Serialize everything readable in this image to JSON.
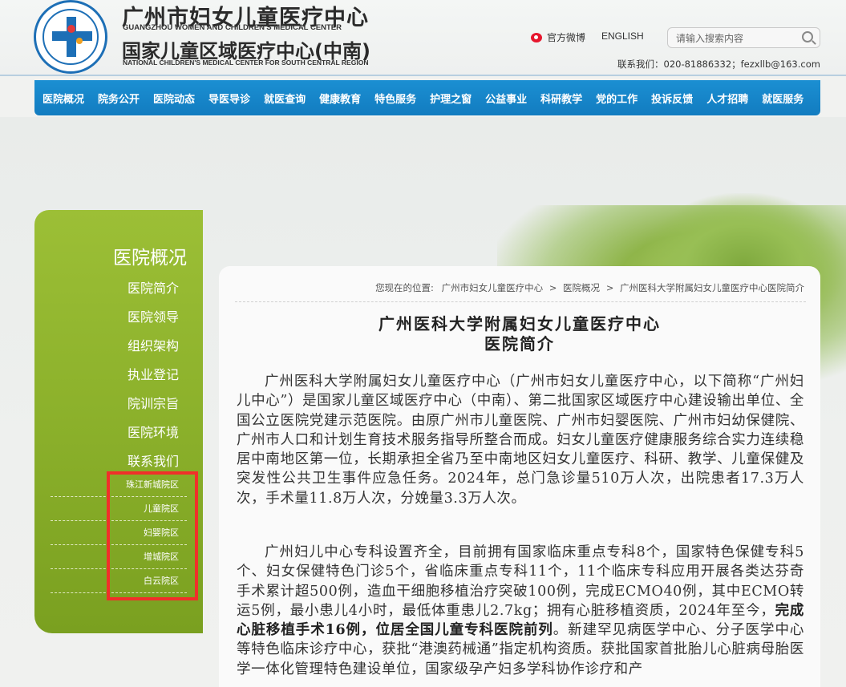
{
  "header": {
    "title_cn": "广州市妇女儿童医疗中心",
    "title_en": "GUANGZHOU WOMEN AND CHILDREN'S MEDICAL CENTER",
    "subtitle_cn": "国家儿童区域医疗中心(中南)",
    "subtitle_en": "NATIONAL CHILDREN'S MEDICAL CENTER FOR SOUTH CENTRAL REGION",
    "weibo_label": "官方微博",
    "english_label": "ENGLISH",
    "search_placeholder": "请输入搜索内容",
    "contact": "联系我们：020-81886332；fezxllb@163.com"
  },
  "nav": {
    "items": [
      "医院概况",
      "院务公开",
      "医院动态",
      "导医导诊",
      "就医查询",
      "健康教育",
      "特色服务",
      "护理之窗",
      "公益事业",
      "科研教学",
      "党的工作",
      "投诉反馈",
      "人才招聘",
      "就医服务"
    ]
  },
  "sidebar": {
    "title": "医院概况",
    "items": [
      "医院简介",
      "医院领导",
      "组织架构",
      "执业登记",
      "院训宗旨",
      "医院环境",
      "联系我们"
    ],
    "sub_items": [
      "珠江新城院区",
      "儿童院区",
      "妇婴院区",
      "增城院区",
      "白云院区"
    ]
  },
  "breadcrumb": {
    "prefix": "您现在的位置:",
    "items": [
      "广州市妇女儿童医疗中心",
      "医院概况",
      "广州医科大学附属妇女儿童医疗中心医院简介"
    ],
    "sep": ">"
  },
  "article": {
    "title_line1": "广州医科大学附属妇女儿童医疗中心",
    "title_line2": "医院简介",
    "para1": "广州医科大学附属妇女儿童医疗中心（广州市妇女儿童医疗中心，以下简称“广州妇儿中心”）是国家儿童区域医疗中心（中南）、第二批国家区域医疗中心建设输出单位、全国公立医院党建示范医院。由原广州市儿童医院、广州市妇婴医院、广州市妇幼保健院、广州市人口和计划生育技术服务指导所整合而成。妇女儿童医疗健康服务综合实力连续稳居中南地区第一位，长期承担全省乃至中南地区妇女儿童医疗、科研、教学、儿童保健及突发性公共卫生事件应急任务。2024年，总门急诊量510万人次，出院患者17.3万人次，手术量11.8万人次，分娩量3.3万人次。",
    "para2_a": "广州妇儿中心专科设置齐全，目前拥有国家临床重点专科8个，国家特色保健专科5个、妇女保健特色门诊5个，省临床重点专科11个，11个临床专科应用开展各类达芬奇手术累计超500例，造血干细胞移植治疗突破100例，完成ECMO40例，其中ECMO转运5例，最小患儿4小时，最低体重患儿2.7kg；拥有心脏移植资质，2024年至今，",
    "para2_b": "完成心脏移植手术16例，位居全国儿童专科医院前列",
    "para2_c": "。新建罕见病医学中心、分子医学中心等特色临床诊疗中心，获批“港澳药械通”指定机构资质。获批国家首批胎儿心脏病母胎医学一体化管理特色建设单位，国家级孕产妇多学科协作诊疗和产"
  }
}
